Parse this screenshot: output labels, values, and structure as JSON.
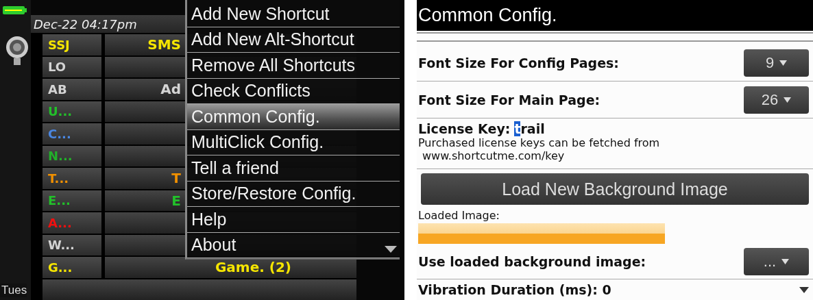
{
  "phone_screen": {
    "status_date": "Dec-22 04:17pm",
    "day_label": "Tues",
    "shortcuts": [
      {
        "key": "SSJ",
        "color": "#f5e500",
        "label": "SMS"
      },
      {
        "key": "LO",
        "color": "#d4d4d4"
      },
      {
        "key": "AB",
        "color": "#d4d4d4",
        "label": "Ad"
      },
      {
        "key": "U...",
        "color": "#22c02a"
      },
      {
        "key": "C...",
        "color": "#4a86e0"
      },
      {
        "key": "N...",
        "color": "#22b02a"
      },
      {
        "key": "T...",
        "color": "#f09000",
        "label": "T"
      },
      {
        "key": "E...",
        "color": "#22c02a",
        "label": "E"
      },
      {
        "key": "A...",
        "color": "#f01010"
      },
      {
        "key": "W...",
        "color": "#d4d4d4"
      },
      {
        "key": "G...",
        "color": "#f5e500",
        "label": "Game. (2)"
      }
    ]
  },
  "menu": {
    "items": [
      {
        "label": "Add New Shortcut",
        "selected": false
      },
      {
        "label": "Add New Alt-Shortcut",
        "selected": false
      },
      {
        "label": "Remove All Shortcuts",
        "selected": false
      },
      {
        "label": "Check Conflicts",
        "selected": false
      },
      {
        "label": "Common Config.",
        "selected": true
      },
      {
        "label": "MultiClick Config.",
        "selected": false
      },
      {
        "label": "Tell a friend",
        "selected": false
      },
      {
        "label": "Store/Restore Config.",
        "selected": false
      },
      {
        "label": "Help",
        "selected": false
      },
      {
        "label": "About",
        "selected": false
      }
    ]
  },
  "config_page": {
    "title": "Common Config.",
    "settings": [
      {
        "kind": "dropdown",
        "label": "Font Size For Config Pages:",
        "value": "9"
      },
      {
        "kind": "dropdown",
        "label": "Font Size For Main Page:",
        "value": "26"
      },
      {
        "kind": "license",
        "label": "License Key:",
        "value": "trail",
        "note": "Purchased license keys can be fetched from",
        "url": "www.shortcutme.com/key"
      },
      {
        "kind": "button",
        "label": "Load New Background Image"
      },
      {
        "kind": "image",
        "label": "Loaded Image:"
      },
      {
        "kind": "dropdown",
        "label": "Use loaded background image:",
        "value": "..."
      },
      {
        "kind": "text",
        "label": "Vibration Duration (ms): 0"
      }
    ]
  }
}
